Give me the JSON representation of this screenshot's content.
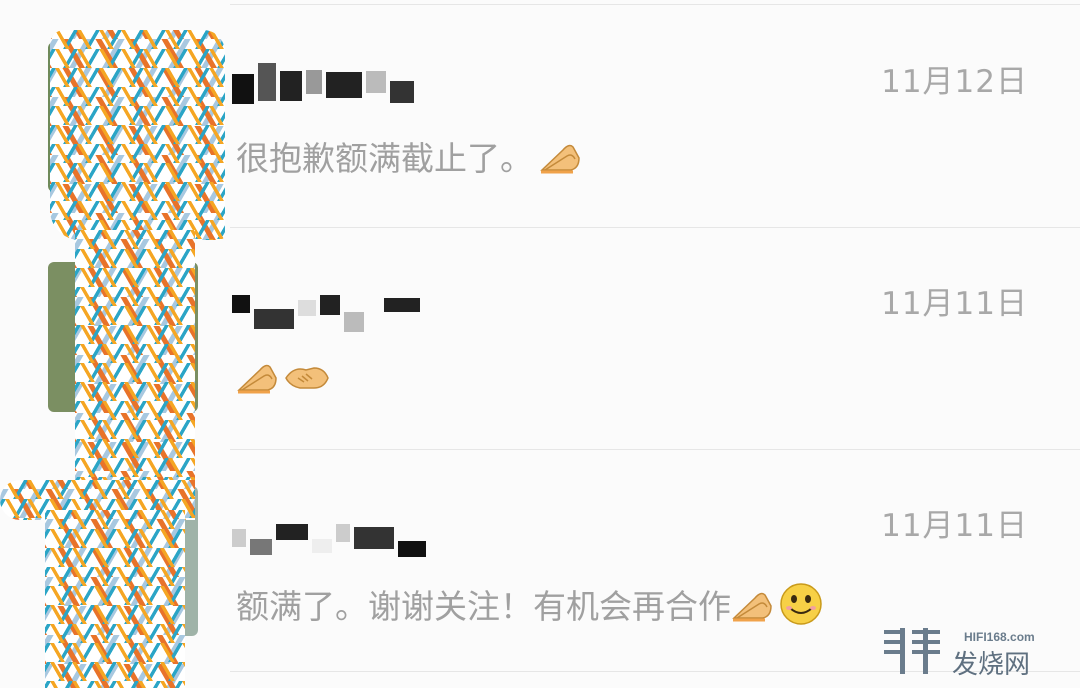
{
  "chats": [
    {
      "time": "11月12日",
      "preview": "很抱歉额满截止了。",
      "emojis": [
        "praying-hands-icon"
      ]
    },
    {
      "time": "11月11日",
      "preview": "",
      "emojis": [
        "praying-hands-icon",
        "handshake-icon"
      ]
    },
    {
      "time": "11月11日",
      "preview": "额满了。谢谢关注！有机会再合作",
      "emojis": [
        "praying-hands-icon",
        "smile-icon"
      ]
    }
  ],
  "watermark": {
    "domain": "HIFI168.com",
    "name": "发烧网"
  },
  "colors": {
    "mosaic": [
      "#f5a623",
      "#2ba5c6",
      "#e8732a",
      "#a8c8e0"
    ],
    "secondary_text": "#a0a0a0"
  }
}
